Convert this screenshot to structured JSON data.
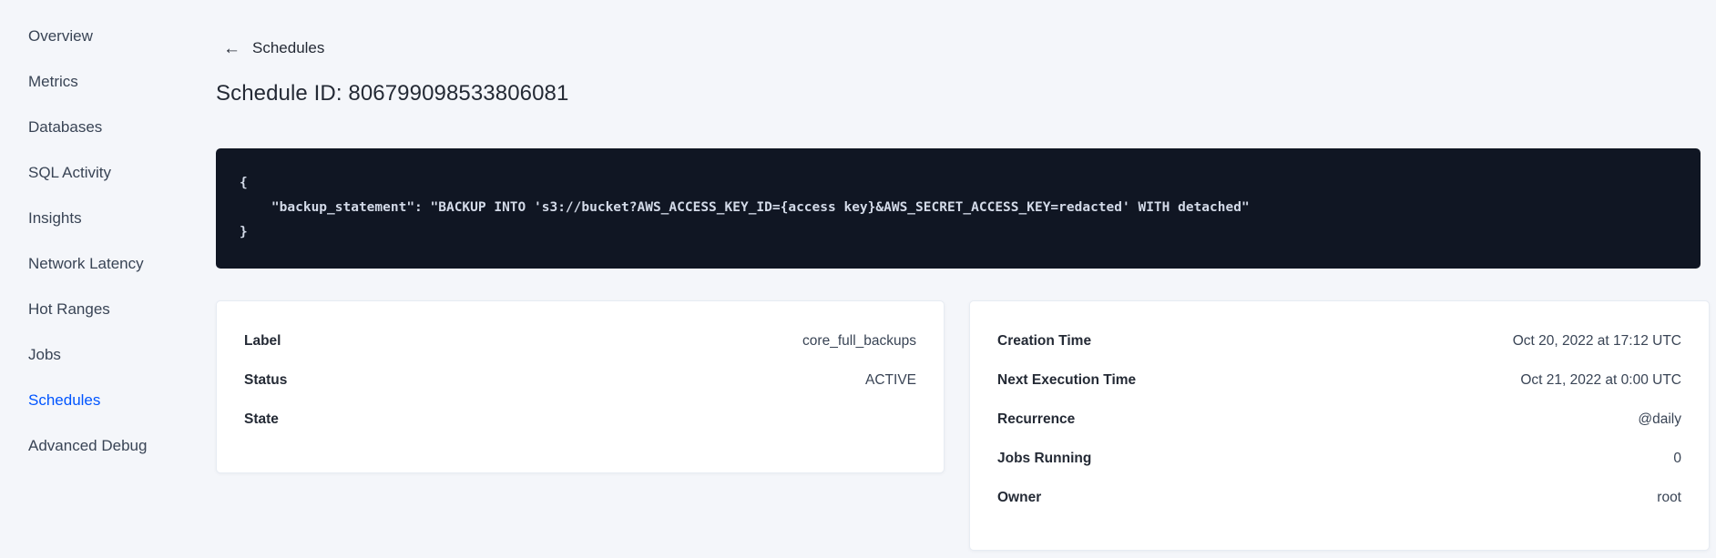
{
  "sidebar": {
    "items": [
      {
        "label": "Overview",
        "active": false
      },
      {
        "label": "Metrics",
        "active": false
      },
      {
        "label": "Databases",
        "active": false
      },
      {
        "label": "SQL Activity",
        "active": false
      },
      {
        "label": "Insights",
        "active": false
      },
      {
        "label": "Network Latency",
        "active": false
      },
      {
        "label": "Hot Ranges",
        "active": false
      },
      {
        "label": "Jobs",
        "active": false
      },
      {
        "label": "Schedules",
        "active": true
      },
      {
        "label": "Advanced Debug",
        "active": false
      }
    ]
  },
  "header": {
    "back_icon": "left-arrow",
    "back_label": "Schedules",
    "title": "Schedule ID: 806799098533806081"
  },
  "code_block": {
    "lines": [
      "{",
      "    \"backup_statement\": \"BACKUP INTO 's3://bucket?AWS_ACCESS_KEY_ID={access key}&AWS_SECRET_ACCESS_KEY=redacted' WITH detached\"",
      "}"
    ]
  },
  "details_card": {
    "rows": [
      {
        "label": "Label",
        "value": "core_full_backups"
      },
      {
        "label": "Status",
        "value": "ACTIVE"
      },
      {
        "label": "State",
        "value": ""
      }
    ]
  },
  "schedule_card": {
    "rows": [
      {
        "label": "Creation Time",
        "value": "Oct 20, 2022 at 17:12 UTC"
      },
      {
        "label": "Next Execution Time",
        "value": "Oct 21, 2022 at 0:00 UTC"
      },
      {
        "label": "Recurrence",
        "value": "@daily"
      },
      {
        "label": "Jobs Running",
        "value": "0"
      },
      {
        "label": "Owner",
        "value": "root"
      }
    ]
  },
  "colors": {
    "page_background": "#f4f6fa",
    "accent_blue": "#0055ff",
    "code_background": "#101623",
    "code_text": "#d3dae8",
    "text_dark": "#242a35",
    "sidebar_text": "#394455",
    "card_border": "#e7ecf3"
  }
}
